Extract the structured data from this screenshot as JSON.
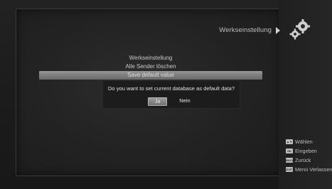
{
  "header": {
    "title": "Werkseinstellung"
  },
  "menu": {
    "items": [
      {
        "label": "Werkseinstellung",
        "selected": false
      },
      {
        "label": "Alle Sender löschen",
        "selected": false
      },
      {
        "label": "Save default value",
        "selected": true
      }
    ]
  },
  "dialog": {
    "message": "Do you want to set current database as default data?",
    "yes_label": "Ja",
    "no_label": "Nein",
    "focused": "yes"
  },
  "legend": {
    "items": [
      {
        "key": "▲▼",
        "label": "Wählen",
        "icon": "updown-key-icon"
      },
      {
        "key": "OK",
        "label": "Eingeben",
        "icon": "ok-key-icon"
      },
      {
        "key": "BACK",
        "label": "Zurück",
        "icon": "back-key-icon"
      },
      {
        "key": "EXIT",
        "label": "Menü Verlassen",
        "icon": "exit-key-icon"
      }
    ]
  },
  "colors": {
    "background": "#1a1a1a",
    "highlight": "#8a8a8a",
    "text": "#c9c9c9"
  },
  "icons": {
    "header_icon": "gear-icon",
    "arrow": "arrow-right-icon"
  }
}
